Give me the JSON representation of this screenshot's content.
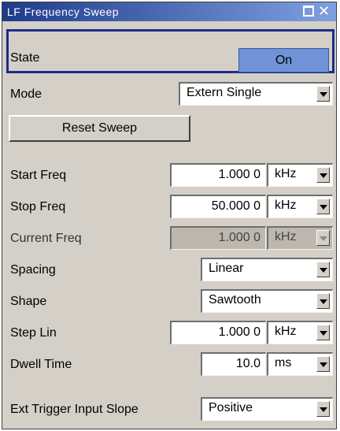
{
  "window": {
    "title": "LF Frequency Sweep"
  },
  "state": {
    "label": "State",
    "value": "On"
  },
  "mode": {
    "label": "Mode",
    "value": "Extern Single"
  },
  "reset_button": "Reset Sweep",
  "start_freq": {
    "label": "Start Freq",
    "value": "1.000 0",
    "unit": "kHz"
  },
  "stop_freq": {
    "label": "Stop Freq",
    "value": "50.000 0",
    "unit": "kHz"
  },
  "current_freq": {
    "label": "Current Freq",
    "value": "1.000 0",
    "unit": "kHz"
  },
  "spacing": {
    "label": "Spacing",
    "value": "Linear"
  },
  "shape": {
    "label": "Shape",
    "value": "Sawtooth"
  },
  "step_lin": {
    "label": "Step Lin",
    "value": "1.000 0",
    "unit": "kHz"
  },
  "dwell_time": {
    "label": "Dwell Time",
    "value": "10.0",
    "unit": "ms"
  },
  "ext_trigger": {
    "label": "Ext Trigger Input Slope",
    "value": "Positive"
  },
  "colors": {
    "state_on": "#6f93d6",
    "title_bar_start": "#1e3a8a",
    "title_bar_end": "#7fa0e0",
    "panel": "#d4d0c8"
  }
}
